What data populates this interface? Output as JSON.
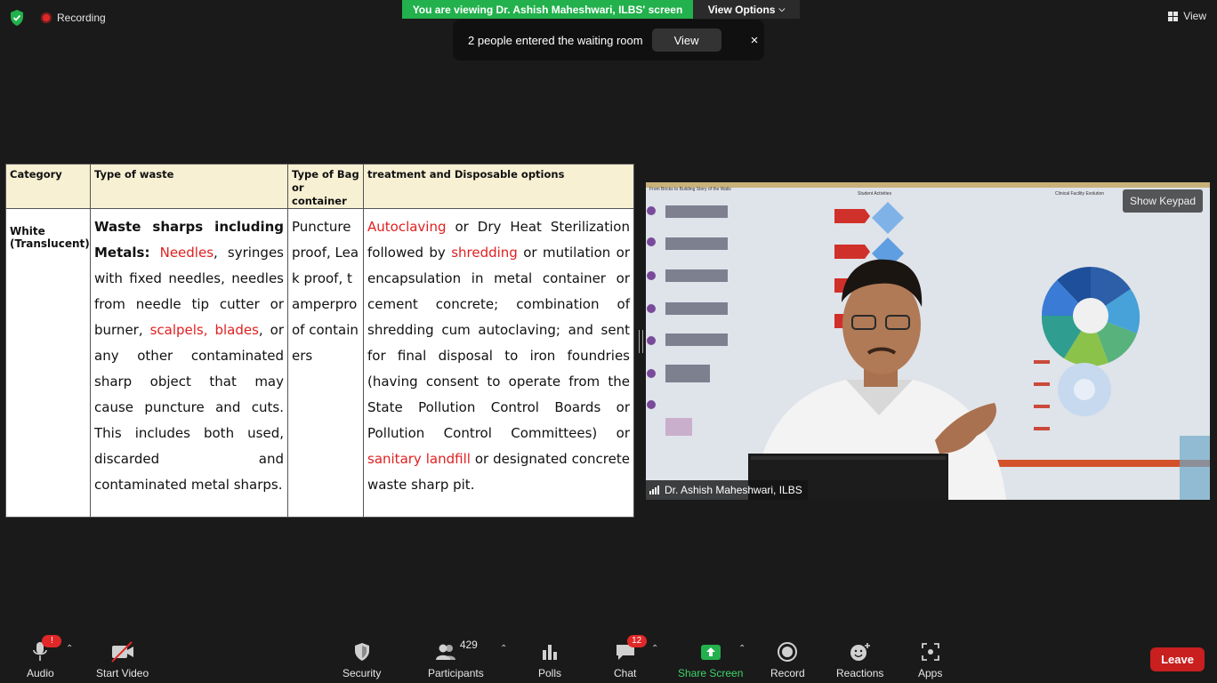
{
  "top": {
    "recording_label": "Recording",
    "viewing_banner": "You are viewing Dr. Ashish Maheshwari, ILBS' screen",
    "view_options_label": "View Options",
    "view_label": "View"
  },
  "notification": {
    "message": "2 people entered the waiting room",
    "view_button": "View",
    "close": "×"
  },
  "slide": {
    "headers": [
      "Category",
      "Type of waste",
      "Type of Bag or container",
      "treatment and Disposable options"
    ],
    "category": "White (Translucent)",
    "waste": {
      "bold_lead": "Waste sharps including Metals:",
      "needles": "Needles",
      "text1": ", syringes with fixed needles, needles from needle tip cutter or burner,",
      "scalpels_blades": "scalpels, blades",
      "text2": ", or any other contaminated sharp object that may cause puncture and cuts. This includes both used, discarded and contaminated metal sharps."
    },
    "container": "Puncture proof, Leak proof, tamperpro of containers",
    "treatment": {
      "autoclaving": "Autoclaving",
      "text1": "or Dry Heat Sterilization followed by",
      "shredding": "shredding",
      "text2": "or mutilation or encapsulation in metal container or cement concrete; combination of shredding cum autoclaving; and sent for final disposal to iron foundries (having consent to operate from the State Pollution Control Boards or Pollution Control Committees) or",
      "landfill": "sanitary landfill",
      "text3": "or designated concrete waste sharp pit."
    }
  },
  "video": {
    "show_keypad": "Show Keypad",
    "participant_name": "Dr. Ashish Maheshwari, ILBS",
    "poster_texts": [
      "From Bricks to Building Story of the Walls",
      "Student Activities",
      "Clinical Facility Evolution"
    ]
  },
  "toolbar": {
    "audio": "Audio",
    "audio_badge": "!",
    "start_video": "Start Video",
    "security": "Security",
    "participants": "Participants",
    "participants_count": "429",
    "polls": "Polls",
    "chat": "Chat",
    "chat_badge": "12",
    "share_screen": "Share Screen",
    "record": "Record",
    "reactions": "Reactions",
    "apps": "Apps",
    "leave": "Leave"
  },
  "colors": {
    "banner_green": "#22b14c",
    "leave_red": "#c91f1f",
    "highlight_red": "#e02020",
    "header_cream": "#f7f0d3"
  }
}
